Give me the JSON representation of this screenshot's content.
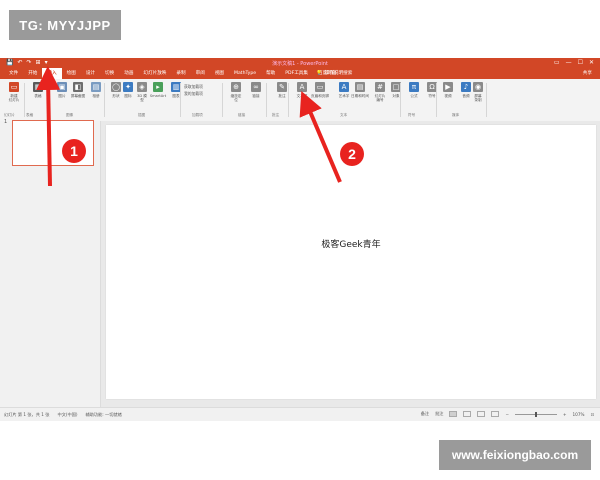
{
  "watermarks": {
    "top_left": "TG: MYYJJPP",
    "bottom_right": "www.feixiongbao.com"
  },
  "titlebar": {
    "title": "演示文稿1 - PowerPoint",
    "quick_access": [
      "💾",
      "↶",
      "↷",
      "⊞",
      "▾"
    ],
    "controls": [
      "▭",
      "—",
      "☐",
      "✕"
    ]
  },
  "tabs": [
    {
      "label": "文件",
      "active": false
    },
    {
      "label": "开始",
      "active": false
    },
    {
      "label": "插入",
      "active": true
    },
    {
      "label": "绘图",
      "active": false
    },
    {
      "label": "设计",
      "active": false
    },
    {
      "label": "切换",
      "active": false
    },
    {
      "label": "动画",
      "active": false
    },
    {
      "label": "幻灯片放映",
      "active": false
    },
    {
      "label": "录制",
      "active": false
    },
    {
      "label": "审阅",
      "active": false
    },
    {
      "label": "视图",
      "active": false
    },
    {
      "label": "MathType",
      "active": false
    },
    {
      "label": "帮助",
      "active": false
    },
    {
      "label": "PDF工具集",
      "active": false
    },
    {
      "label": "百度网盘",
      "active": false
    }
  ],
  "tell_me": {
    "icon": "lightbulb-icon",
    "label": "操作说明搜索"
  },
  "share": "共享",
  "ribbon": {
    "buttons": [
      {
        "id": "new-slide",
        "label": "新建\n幻灯片",
        "icon": "new-slide-icon",
        "color": "#d24726",
        "glyph": "▭"
      },
      {
        "id": "table",
        "label": "表格",
        "icon": "table-icon",
        "color": "#5a5a5a",
        "glyph": "▦"
      },
      {
        "id": "image",
        "label": "图片",
        "icon": "image-icon",
        "color": "#6d8fb8",
        "glyph": "▣"
      },
      {
        "id": "screenshot",
        "label": "屏幕截图",
        "icon": "screenshot-icon",
        "color": "#6d6d6d",
        "glyph": "◧"
      },
      {
        "id": "album",
        "label": "相册",
        "icon": "album-icon",
        "color": "#7a9cc2",
        "glyph": "▤"
      },
      {
        "id": "shapes",
        "label": "形状",
        "icon": "shapes-icon",
        "color": "#8a8a8a",
        "glyph": "◯"
      },
      {
        "id": "icons",
        "label": "图标",
        "icon": "icons-icon",
        "color": "#3c7bc2",
        "glyph": "✦"
      },
      {
        "id": "3d",
        "label": "3D 模\n型",
        "icon": "3d-model-icon",
        "color": "#8a8a8a",
        "glyph": "◈"
      },
      {
        "id": "smartart",
        "label": "SmartArt",
        "icon": "smartart-icon",
        "color": "#4aa05a",
        "glyph": "▸"
      },
      {
        "id": "chart",
        "label": "图表",
        "icon": "chart-icon",
        "color": "#3c7bc2",
        "glyph": "▥"
      },
      {
        "id": "zoom",
        "label": "缩放定\n位",
        "icon": "zoom-icon",
        "color": "#8a8a8a",
        "glyph": "⊕"
      },
      {
        "id": "link",
        "label": "链接",
        "icon": "link-icon",
        "color": "#8a8a8a",
        "glyph": "∞"
      },
      {
        "id": "comment",
        "label": "批注",
        "icon": "comment-icon",
        "color": "#8a8a8a",
        "glyph": "✎"
      },
      {
        "id": "textbox",
        "label": "文本框",
        "icon": "textbox-icon",
        "color": "#8a8a8a",
        "glyph": "A"
      },
      {
        "id": "header-footer",
        "label": "页眉和页脚",
        "icon": "header-footer-icon",
        "color": "#8a8a8a",
        "glyph": "▭"
      },
      {
        "id": "wordart",
        "label": "艺术字",
        "icon": "wordart-icon",
        "color": "#3c7bc2",
        "glyph": "A"
      },
      {
        "id": "date-time",
        "label": "日期和时间",
        "icon": "date-time-icon",
        "color": "#8a8a8a",
        "glyph": "▤"
      },
      {
        "id": "slide-number",
        "label": "幻灯片\n编号",
        "icon": "slide-number-icon",
        "color": "#8a8a8a",
        "glyph": "#"
      },
      {
        "id": "object",
        "label": "对象",
        "icon": "object-icon",
        "color": "#8a8a8a",
        "glyph": "□"
      },
      {
        "id": "equation",
        "label": "公式",
        "icon": "equation-icon",
        "color": "#3c7bc2",
        "glyph": "π"
      },
      {
        "id": "symbol",
        "label": "符号",
        "icon": "symbol-icon",
        "color": "#8a8a8a",
        "glyph": "Ω"
      },
      {
        "id": "video",
        "label": "视频",
        "icon": "video-icon",
        "color": "#8a8a8a",
        "glyph": "▶"
      },
      {
        "id": "audio",
        "label": "音频",
        "icon": "audio-icon",
        "color": "#3c7bc2",
        "glyph": "♪"
      },
      {
        "id": "screen-record",
        "label": "屏幕\n录制",
        "icon": "screen-record-icon",
        "color": "#8a8a8a",
        "glyph": "◉"
      }
    ],
    "addins": [
      "获取加载项",
      "我的加载项"
    ],
    "groups": [
      "幻灯片",
      "表格",
      "图像",
      "插图",
      "加载项",
      "链接",
      "批注",
      "文本",
      "符号",
      "媒体"
    ]
  },
  "slides_panel": {
    "number": "1"
  },
  "slide": {
    "text": "极客Geek青年"
  },
  "statusbar": {
    "slide_info": "幻灯片 第 1 张，共 1 张",
    "language": "中文(中国)",
    "accessibility": "辅助功能: 一切就绪",
    "notes": "备注",
    "comments": "批注",
    "zoom": "107%"
  },
  "callouts": [
    {
      "number": "1",
      "target": "insert-tab"
    },
    {
      "number": "2",
      "target": "textbox-button"
    }
  ],
  "colors": {
    "accent": "#d24726",
    "callout": "#e8231f"
  }
}
